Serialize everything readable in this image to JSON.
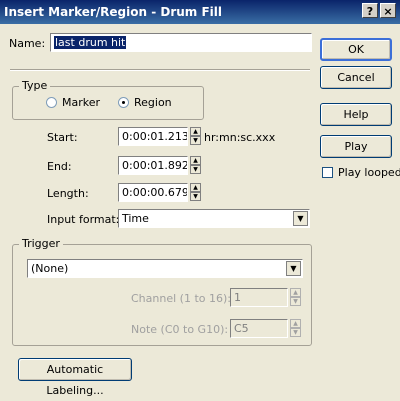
{
  "dialog": {
    "title": "Insert Marker/Region - Drum Fill",
    "help_glyph": "?",
    "close_glyph": "×"
  },
  "name": {
    "label": "Name:",
    "value": "last drum hit"
  },
  "type": {
    "legend": "Type",
    "marker_label": "Marker",
    "region_label": "Region",
    "selected": "Region"
  },
  "start": {
    "label": "Start:",
    "value": "0:00:01.213",
    "hint": "hr:mn:sc.xxx"
  },
  "end": {
    "label": "End:",
    "value": "0:00:01.892"
  },
  "length": {
    "label": "Length:",
    "value": "0:00:00.679"
  },
  "input_format": {
    "label": "Input format:",
    "value": "Time"
  },
  "trigger": {
    "legend": "Trigger",
    "value": "(None)",
    "channel_label": "Channel (1 to 16):",
    "channel_value": "1",
    "note_label": "Note (C0 to G10):",
    "note_value": "C5"
  },
  "buttons": {
    "ok": "OK",
    "cancel": "Cancel",
    "help": "Help",
    "play": "Play",
    "play_looped": "Play looped",
    "automatic_labeling": "Automatic Labeling..."
  },
  "icons": {
    "spin_up": "▲",
    "spin_down": "▼",
    "dropdown": "▼"
  },
  "play_looped_checked": false
}
